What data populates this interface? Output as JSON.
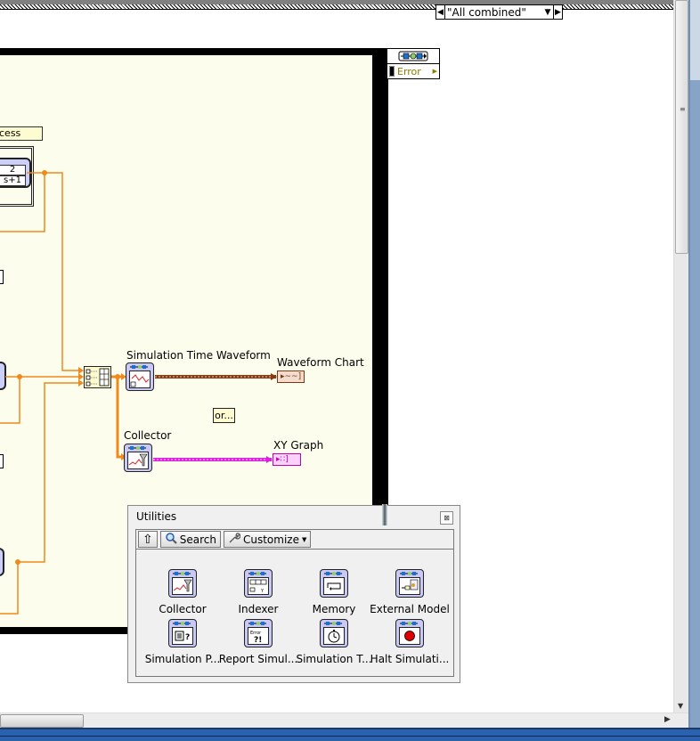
{
  "case_selector": {
    "value": "\"All combined\"",
    "prev_icon": "left-triangle",
    "next_icon": "right-triangle",
    "dropdown_icon": "down-triangle"
  },
  "error_terminal": {
    "label": "Error",
    "icon": "subsystem-io-icon"
  },
  "left_partial": {
    "process_label": "cess",
    "counter_line1": "2",
    "counter_line2": "s+1"
  },
  "nodes": {
    "sim_time_waveform": "Simulation Time Waveform",
    "waveform_chart": "Waveform Chart",
    "collector": "Collector",
    "xy_graph": "XY Graph",
    "or_label": "or..."
  },
  "indicators": {
    "chart_glyph": "▸~~]",
    "xy_glyph": "▸∷]"
  },
  "palette": {
    "title": "Utilities",
    "close_icon": "close-icon",
    "toolbar": {
      "up_label": "⇧",
      "search_label": "Search",
      "customize_label": "Customize"
    },
    "items": [
      {
        "label": "Collector",
        "icon": "collector-icon"
      },
      {
        "label": "Indexer",
        "icon": "indexer-icon"
      },
      {
        "label": "Memory",
        "icon": "memory-icon"
      },
      {
        "label": "External Model",
        "icon": "external-model-icon"
      },
      {
        "label": "Simulation P...",
        "icon": "simulation-parameters-icon"
      },
      {
        "label": "Report Simul...",
        "icon": "report-simulation-error-icon"
      },
      {
        "label": "Simulation T...",
        "icon": "simulation-time-icon"
      },
      {
        "label": "Halt Simulati...",
        "icon": "halt-simulation-icon"
      }
    ]
  },
  "colors": {
    "diagram_bg": "#fdfdee",
    "wire_numeric": "#f08a1c",
    "wire_waveform": "#8a3a10",
    "wire_xy": "#e020e0",
    "vi_icon": "#c9c9f5"
  }
}
